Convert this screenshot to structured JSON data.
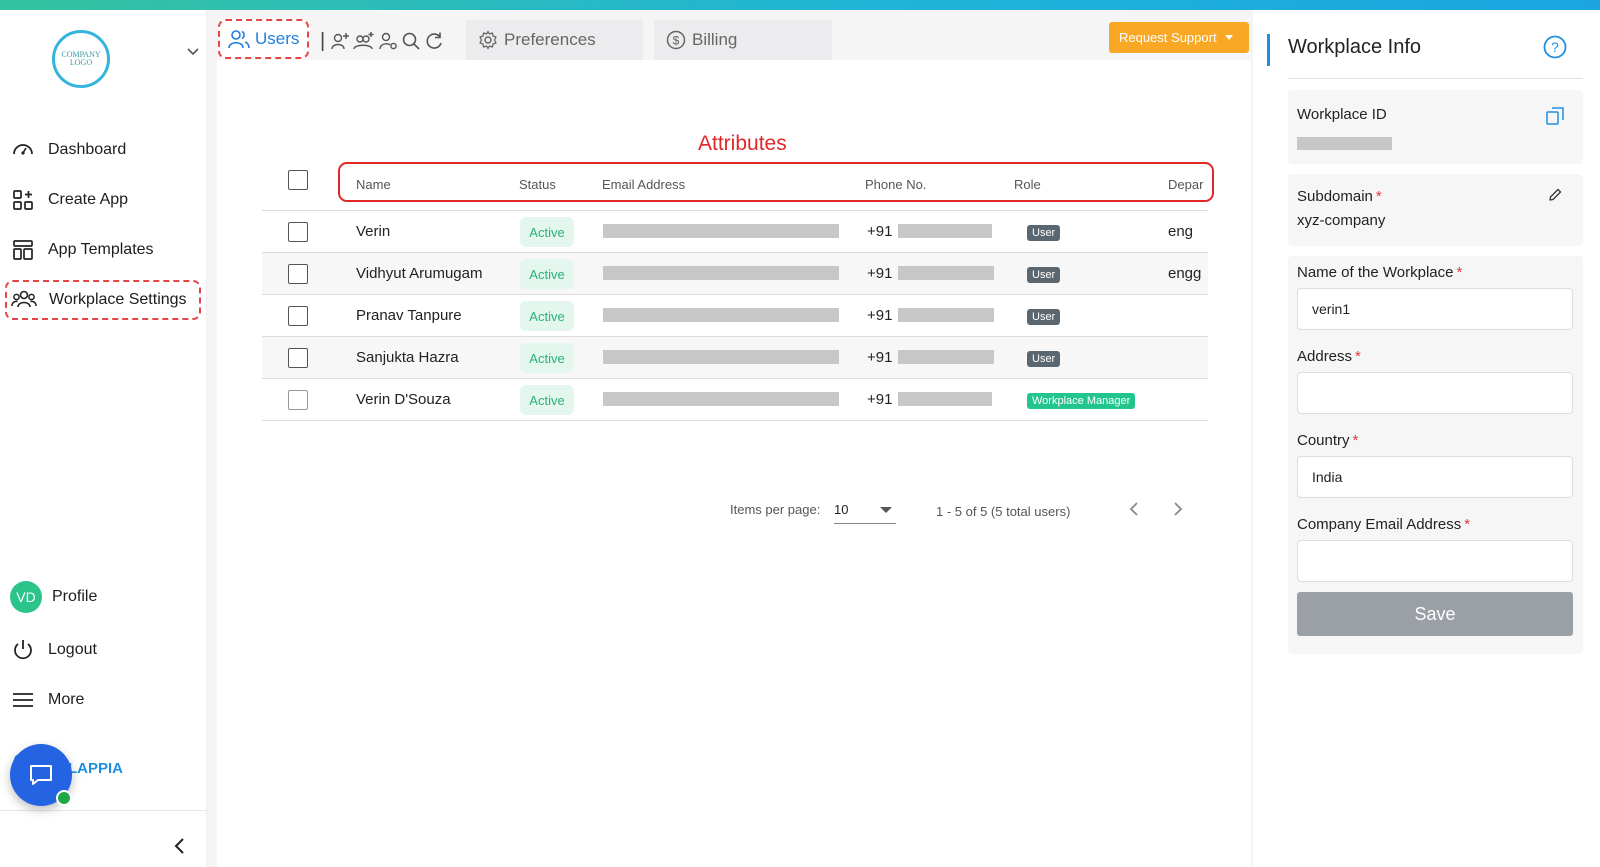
{
  "sidebar": {
    "logo_text_line1": "COMPANY",
    "logo_text_line2": "LOGO",
    "nav": [
      {
        "label": "Dashboard",
        "icon": "dashboard-icon"
      },
      {
        "label": "Create App",
        "icon": "create-app-icon"
      },
      {
        "label": "App Templates",
        "icon": "templates-icon"
      },
      {
        "label": "Workplace Settings",
        "icon": "users-group-icon",
        "active": true
      }
    ],
    "profile": {
      "initials": "VD",
      "label": "Profile"
    },
    "logout_label": "Logout",
    "more_label": "More",
    "brand_text": "LAPPIA"
  },
  "tabs": {
    "users": "Users",
    "separator": "|",
    "preferences": "Preferences",
    "billing": "Billing"
  },
  "request_support": "Request Support",
  "annotation": {
    "label": "Attributes",
    "color": "#e02828"
  },
  "table": {
    "headers": [
      "Name",
      "Status",
      "Email Address",
      "Phone No.",
      "Role",
      "Depar"
    ],
    "rows": [
      {
        "name": "Verin",
        "status": "Active",
        "phone_prefix": "+91",
        "role": "User",
        "department": "eng"
      },
      {
        "name": "Vidhyut Arumugam",
        "status": "Active",
        "phone_prefix": "+91",
        "role": "User",
        "department": "engg"
      },
      {
        "name": "Pranav Tanpure",
        "status": "Active",
        "phone_prefix": "+91",
        "role": "User",
        "department": ""
      },
      {
        "name": "Sanjukta Hazra",
        "status": "Active",
        "phone_prefix": "+91",
        "role": "User",
        "department": ""
      },
      {
        "name": "Verin D'Souza",
        "status": "Active",
        "phone_prefix": "+91",
        "role": "Workplace Manager",
        "department": ""
      }
    ]
  },
  "pagination": {
    "items_per_page_label": "Items per page:",
    "items_per_page_value": "10",
    "range_text": "1 - 5 of 5 (5 total users)"
  },
  "workplace_info": {
    "title": "Workplace Info",
    "workplace_id_label": "Workplace ID",
    "subdomain_label": "Subdomain",
    "subdomain_value": "xyz-company",
    "name_label": "Name of the Workplace",
    "name_value": "verin1",
    "address_label": "Address",
    "address_value": "",
    "country_label": "Country",
    "country_value": "India",
    "email_label": "Company Email Address",
    "email_value": "",
    "required_mark": "*",
    "save_label": "Save"
  },
  "colors": {
    "accent": "#1e90e0",
    "warning_button": "#f9a825",
    "active_badge_bg": "#e3f7ee",
    "active_badge_text": "#2ab07a",
    "manager_badge": "#22c68c",
    "annotation": "#e02828"
  }
}
